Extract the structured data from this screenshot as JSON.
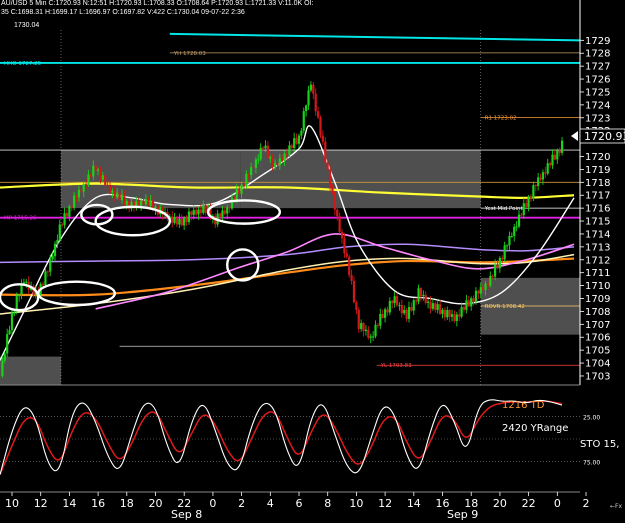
{
  "header": {
    "line1": "AU/USD 5 Min C:1720.93 N:12:51 H:1720.93 L:1708.33 O:1708.64 P:1720.93 L:1721.33 V:11.0K OI:",
    "line2": "35 C:1698.31 H:1699.17 L:1696.97 O:1697.82 V:422 C:1730.04 09-07-22 2:36",
    "line3": "1730.04"
  },
  "colors": {
    "background": "#000000",
    "up_candle": "#19d219",
    "down_candle": "#d21919",
    "yellow_ma": "#ffff33",
    "orange_ma": "#ff8c1a",
    "white_ma": "#ffffff",
    "pink_ma": "#ff88ff",
    "lavender_ma": "#b48cff",
    "cream_ma": "#fff2b3",
    "magenta_pivot": "#e020e0",
    "cyan_level": "#00e5e5",
    "stoch_k": "#ffffff",
    "stoch_d": "#e01a1a",
    "zone_fill": "#6a6a6a"
  },
  "chart_data": {
    "type": "candlestick",
    "price_axis": {
      "ylim": [
        1702.3,
        1729.8
      ],
      "ticks": [
        1703,
        1704,
        1705,
        1706,
        1707,
        1708,
        1709,
        1710,
        1711,
        1712,
        1713,
        1714,
        1715,
        1716,
        1717,
        1718,
        1719,
        1720,
        1721,
        1722,
        1723,
        1724,
        1725,
        1726,
        1727,
        1728,
        1729
      ],
      "current_price_label": "1720.93",
      "current_price": 1720.93
    },
    "x_axis": {
      "hour_labels": [
        "10",
        "12",
        "14",
        "16",
        "18",
        "20",
        "22",
        "0",
        "2",
        "4",
        "6",
        "8",
        "10",
        "12",
        "14",
        "16",
        "18",
        "20",
        "22",
        "0",
        "2"
      ],
      "day_labels": [
        "Sep 8",
        "Sep 9"
      ],
      "corner_label": "←Fx"
    },
    "close_path": [
      [
        0,
        1703.0
      ],
      [
        1,
        1707.8
      ],
      [
        2,
        1710.5
      ],
      [
        3,
        1709.2
      ],
      [
        4,
        1711.2
      ],
      [
        5,
        1714.5
      ],
      [
        6,
        1716.4
      ],
      [
        7,
        1717.8
      ],
      [
        8,
        1719.2
      ],
      [
        9,
        1717.6
      ],
      [
        10,
        1716.8
      ],
      [
        11,
        1716.2
      ],
      [
        12,
        1716.6
      ],
      [
        13,
        1716.0
      ],
      [
        14,
        1715.4
      ],
      [
        15,
        1714.8
      ],
      [
        16,
        1715.6
      ],
      [
        17,
        1716.0
      ],
      [
        18,
        1715.1
      ],
      [
        19,
        1716.0
      ],
      [
        20,
        1717.4
      ],
      [
        21,
        1719.0
      ],
      [
        22,
        1720.8
      ],
      [
        23,
        1719.2
      ],
      [
        24,
        1720.4
      ],
      [
        25,
        1721.5
      ],
      [
        26,
        1725.8
      ],
      [
        27,
        1720.8
      ],
      [
        28,
        1716.0
      ],
      [
        29,
        1712.0
      ],
      [
        30,
        1707.0
      ],
      [
        31,
        1706.0
      ],
      [
        32,
        1707.8
      ],
      [
        33,
        1709.0
      ],
      [
        34,
        1707.6
      ],
      [
        35,
        1709.5
      ],
      [
        36,
        1708.5
      ],
      [
        37,
        1708.0
      ],
      [
        38,
        1707.5
      ],
      [
        39,
        1708.5
      ],
      [
        40,
        1709.5
      ],
      [
        41,
        1710.5
      ],
      [
        42,
        1712.4
      ],
      [
        43,
        1714.5
      ],
      [
        44,
        1716.4
      ],
      [
        45,
        1718.2
      ],
      [
        46,
        1719.5
      ],
      [
        47,
        1720.93
      ]
    ],
    "candle_noise": [
      0.4,
      -0.3,
      0.6,
      -0.5,
      0.2,
      -0.6,
      0.5,
      -0.2,
      0.3,
      -0.4,
      0.1,
      -0.5
    ],
    "zones": [
      {
        "x0": 0,
        "x1": 5.1,
        "y0": 1702.3,
        "y1": 1704.5
      },
      {
        "x0": 5.1,
        "x1": 20.1,
        "y0": 1716.0,
        "y1": 1720.5
      },
      {
        "x0": 20.1,
        "x1": 40.2,
        "y0": 1716.0,
        "y1": 1720.5
      },
      {
        "x0": 40.2,
        "x1": 48.5,
        "y0": 1706.2,
        "y1": 1710.6
      }
    ],
    "levels": [
      {
        "name": "YH",
        "label": "YH 1728.03",
        "value": 1728.03,
        "color": "#c8a06a",
        "x0": 14.2,
        "x1": 48.5
      },
      {
        "name": "HHO",
        "label": "HHO 1727.25",
        "value": 1727.25,
        "color": "#00e5e5",
        "x0": 0,
        "x1": 48.5
      },
      {
        "name": "R1",
        "label": "R1 1723.02",
        "value": 1723.02,
        "color": "#ff9933",
        "x0": 40.2,
        "x1": 48.5
      },
      {
        "name": "prev-high",
        "label": "",
        "value": 1720.5,
        "color": "#dddddd",
        "x0": 0,
        "x1": 48.5
      },
      {
        "name": "prev-mid",
        "label": "",
        "value": 1718.0,
        "color": "#cc9933",
        "x0": 0,
        "x1": 48.5
      },
      {
        "name": "Yest Mid Point",
        "label": "Yest Mid Point",
        "value": 1716.0,
        "color": "#ffffff",
        "x0": 40.2,
        "x1": 48.5
      },
      {
        "name": "MP",
        "label": "MP 1715.26",
        "value": 1715.26,
        "color": "#e020e0",
        "x0": 0,
        "x1": 48.5
      },
      {
        "name": "ROVR",
        "label": "ROVR 1708.42",
        "value": 1708.42,
        "color": "#ffcc66",
        "x0": 40.2,
        "x1": 48.5
      },
      {
        "name": "mid-low",
        "label": "",
        "value": 1705.3,
        "color": "#cccccc",
        "x0": 10,
        "x1": 40.2
      },
      {
        "name": "YL",
        "label": "YL 1703.83",
        "value": 1703.83,
        "color": "#ff4444",
        "x0": 31.5,
        "x1": 48.5
      }
    ],
    "moving_averages": [
      {
        "name": "yellow-ma",
        "color": "#ffff33",
        "width": 2.2,
        "points": [
          [
            0,
            1717.6
          ],
          [
            8,
            1717.9
          ],
          [
            16,
            1717.6
          ],
          [
            24,
            1717.6
          ],
          [
            32,
            1717.2
          ],
          [
            40,
            1716.9
          ],
          [
            44,
            1716.8
          ],
          [
            48,
            1717.0
          ]
        ]
      },
      {
        "name": "orange-ma",
        "color": "#ff8c1a",
        "width": 2.2,
        "points": [
          [
            0,
            1709.3
          ],
          [
            8,
            1709.3
          ],
          [
            16,
            1710.0
          ],
          [
            24,
            1711.0
          ],
          [
            29,
            1711.6
          ],
          [
            34,
            1711.9
          ],
          [
            40,
            1711.8
          ],
          [
            44,
            1711.9
          ],
          [
            48,
            1712.1
          ]
        ]
      },
      {
        "name": "cream-ma",
        "color": "#fff2b3",
        "width": 1.5,
        "points": [
          [
            0,
            1707.8
          ],
          [
            8,
            1708.6
          ],
          [
            16,
            1709.7
          ],
          [
            24,
            1711.2
          ],
          [
            29,
            1711.9
          ],
          [
            34,
            1712.1
          ],
          [
            40,
            1711.7
          ],
          [
            44,
            1711.8
          ],
          [
            48,
            1712.4
          ]
        ]
      },
      {
        "name": "lavender-ma",
        "color": "#b48cff",
        "width": 1.5,
        "points": [
          [
            0,
            1711.8
          ],
          [
            8,
            1711.9
          ],
          [
            16,
            1712.0
          ],
          [
            24,
            1712.4
          ],
          [
            29,
            1713.0
          ],
          [
            34,
            1713.2
          ],
          [
            40,
            1712.8
          ],
          [
            44,
            1712.7
          ],
          [
            48,
            1713.0
          ]
        ]
      },
      {
        "name": "pink-ma",
        "color": "#ff88ff",
        "width": 1.6,
        "points": [
          [
            8,
            1708.2
          ],
          [
            14,
            1709.5
          ],
          [
            20,
            1711.4
          ],
          [
            24,
            1712.6
          ],
          [
            28,
            1714.0
          ],
          [
            32,
            1713.0
          ],
          [
            36,
            1712.0
          ],
          [
            40,
            1711.3
          ],
          [
            44,
            1712.0
          ],
          [
            48,
            1713.2
          ]
        ]
      },
      {
        "name": "white-ma",
        "color": "#ffffff",
        "width": 1.4,
        "points": [
          [
            0,
            1704.2
          ],
          [
            2,
            1708.0
          ],
          [
            5,
            1713.5
          ],
          [
            8,
            1716.8
          ],
          [
            11,
            1716.8
          ],
          [
            14,
            1716.3
          ],
          [
            18,
            1716.4
          ],
          [
            22,
            1718.6
          ],
          [
            25,
            1720.6
          ],
          [
            26,
            1722.3
          ],
          [
            28,
            1718.0
          ],
          [
            30,
            1713.2
          ],
          [
            33,
            1709.6
          ],
          [
            36,
            1709.0
          ],
          [
            39,
            1708.6
          ],
          [
            42,
            1709.5
          ],
          [
            45,
            1712.5
          ],
          [
            48,
            1716.8
          ]
        ]
      }
    ],
    "ellipses": [
      {
        "x": 1.6,
        "y": 1709.1,
        "rx": 1.6,
        "ry": 1.0
      },
      {
        "x": 6.4,
        "y": 1709.4,
        "rx": 3.2,
        "ry": 0.9
      },
      {
        "x": 8.1,
        "y": 1715.5,
        "rx": 1.3,
        "ry": 0.75
      },
      {
        "x": 11.1,
        "y": 1715.0,
        "rx": 3.1,
        "ry": 1.1
      },
      {
        "x": 20.4,
        "y": 1715.7,
        "rx": 3.0,
        "ry": 0.9
      },
      {
        "x": 20.3,
        "y": 1711.6,
        "rx": 1.3,
        "ry": 1.2
      }
    ],
    "stochastic": {
      "ylim": [
        -5,
        105
      ],
      "ticks": [
        {
          "label": "25.00",
          "value": 75
        },
        {
          "label": "75.00",
          "value": 25
        }
      ],
      "guide_lines": [
        25,
        50,
        75
      ],
      "k": [
        10,
        60,
        90,
        75,
        20,
        10,
        80,
        95,
        70,
        30,
        10,
        55,
        92,
        88,
        40,
        15,
        70,
        95,
        60,
        20,
        12,
        65,
        93,
        85,
        35,
        12,
        75,
        95,
        55,
        18,
        8,
        50,
        90,
        80,
        30,
        10,
        60,
        95,
        70,
        30,
        88,
        95,
        92,
        93,
        90,
        94,
        92,
        88
      ],
      "d_lag_smoothing": 0.35,
      "text_1216": "1216 TD",
      "text_range": "2420 YRange",
      "text_sto": "STO  15,"
    }
  }
}
